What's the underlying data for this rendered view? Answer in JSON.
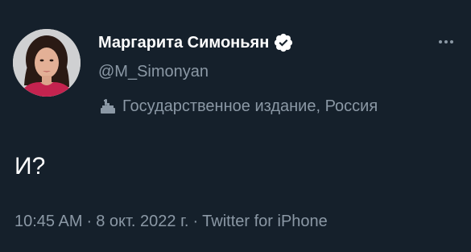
{
  "author": {
    "display_name": "Маргарита Симоньян",
    "handle": "@M_Simonyan",
    "verified": true
  },
  "label": {
    "icon": "podium-icon",
    "text": "Государственное издание, Россия"
  },
  "tweet": {
    "text": "И?"
  },
  "meta": {
    "time": "10:45 AM",
    "separator": "·",
    "date": "8 окт. 2022 г.",
    "source": "Twitter for iPhone"
  },
  "colors": {
    "background": "#15202b",
    "primary_text": "#ffffff",
    "secondary_text": "#8b98a5",
    "verified_badge": "#ffffff"
  }
}
